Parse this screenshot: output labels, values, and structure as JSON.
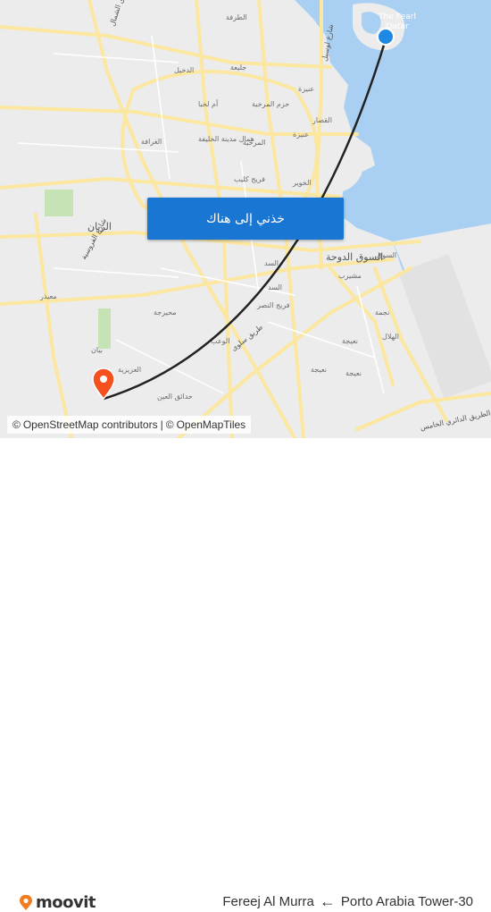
{
  "map": {
    "cta_label": "خذني إلى هناك",
    "attribution": {
      "prefix": "©",
      "osm_contributors": "OpenStreetMap contributors",
      "separator": "|",
      "openmaptiles": "OpenMapTiles"
    },
    "labels": {
      "pearl_line1": "The Pearl",
      "pearl_line2": "Qatar",
      "al_tarfa": "الطرفة",
      "jelaiah": "جليعة",
      "al_dakhil": "الدخيل",
      "onaiza": "عنيزة",
      "umm_lekhba": "أم لخبا",
      "hazm_al_markhiya": "حزم المرخية",
      "al_qassar": "القصار",
      "al_gharafa": "الغرافة",
      "hamal_madinat_khalifa": "همال مدينة الخليفة",
      "al_markhiya": "المرخية",
      "onaiza_2": "عنيزة",
      "fereej_kulaib": "فريج كليب",
      "al_khuwair": "الخوير",
      "al_rayyan": "الريان",
      "souq_al_dawha": "السوق الدوحة",
      "msheireb": "مشيرب",
      "al_sadd": "السد",
      "al_sadd_2": "السد",
      "fereej_al_nasr": "فريج النصر",
      "muaither": "معيذر",
      "mehairja": "محيرجة",
      "najma": "نجمة",
      "al_hilal": "الهلال",
      "nuaija": "نعيجة",
      "nuaija_2": "نعيجة",
      "al_waab": "الوعب",
      "al_aziziya": "العزيزية",
      "hadaiq_al_ain": "حدائق العين",
      "buyan": "بيان",
      "al_furousiya": "شارع الفروسية",
      "salwa_road": "طريق سلوى",
      "al_shamal_road": "طريق الشمال",
      "lusail_road": "شارع لوسيل",
      "ring_road": "الطريق الدائري الخامس",
      "al_mina": "السوق"
    }
  },
  "footer": {
    "logo_text": "moovit",
    "route_from": "Fereej Al Murra",
    "route_arrow": "←",
    "route_to": "Porto Arabia Tower-30"
  },
  "colors": {
    "land": "#ececec",
    "water": "#a9cff2",
    "road": "#fbe79f",
    "park": "#c6e3b5",
    "route_line": "#222222",
    "origin_dot": "#1e88e5",
    "destination_pin": "#f4511e",
    "cta": "#1976d2",
    "logo_orange": "#f47c20"
  }
}
